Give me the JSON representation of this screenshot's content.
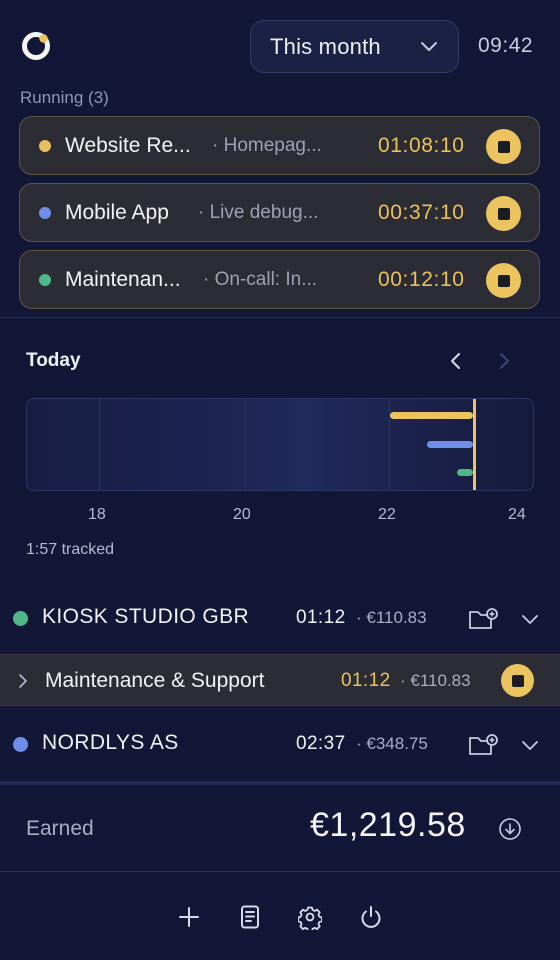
{
  "header": {
    "logo_icon": "app-logo-icon",
    "period_selector": "This month",
    "clock": "09:42"
  },
  "running": {
    "label": "Running (3)",
    "timers": [
      {
        "client_color": "#e7c05a",
        "name": "Website Re...",
        "task": "· Homepag...",
        "time": "01:08:10"
      },
      {
        "client_color": "#6f8ee8",
        "name": "Mobile App",
        "task": "· Live debug...",
        "time": "00:37:10"
      },
      {
        "client_color": "#4fb889",
        "name": "Maintenan...",
        "task": "· On-call: In...",
        "time": "00:12:10"
      }
    ]
  },
  "today": {
    "title": "Today",
    "axis_ticks": [
      "18",
      "20",
      "22",
      "24"
    ],
    "tracked": "1:57 tracked",
    "colors": {
      "yellow": "#ecc45f",
      "blue": "#6f8ee8",
      "green": "#4fb889"
    }
  },
  "clients": [
    {
      "name": "KIOSK STUDIO GBR",
      "color": "#4fb889",
      "time": "01:12",
      "amount": "· €110.83"
    },
    {
      "name": "NORDLYS AS",
      "color": "#6f8ee8",
      "time": "02:37",
      "amount": "· €348.75"
    }
  ],
  "project": {
    "name": "Maintenance & Support",
    "time": "01:12",
    "amount": "· €110.83"
  },
  "earned": {
    "label": "Earned",
    "value": "€1,219.58"
  },
  "footer": {
    "icons": [
      "plus-icon",
      "report-icon",
      "gear-icon",
      "power-icon"
    ]
  }
}
